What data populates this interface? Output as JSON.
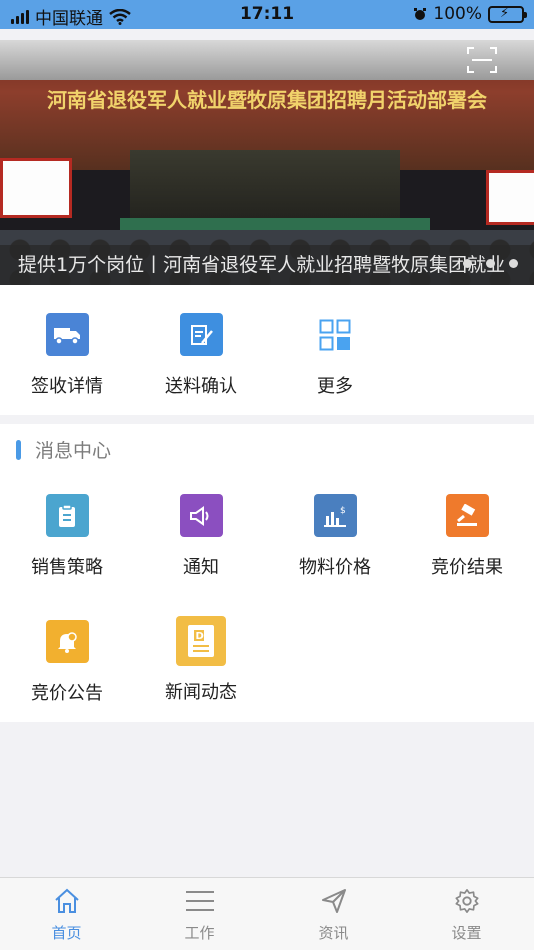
{
  "status_bar": {
    "carrier": "中国联通",
    "time": "17:11",
    "battery": "100%"
  },
  "banner": {
    "title": "河南省退役军人就业暨牧原集团招聘月活动部署会",
    "caption": "提供1万个岗位丨河南省退役军人就业招聘暨牧原集团就业"
  },
  "quick_actions": [
    {
      "label": "签收详情",
      "icon": "truck-icon",
      "color": "#4a84d6"
    },
    {
      "label": "送料确认",
      "icon": "sign-document-icon",
      "color": "#3e8fe0"
    },
    {
      "label": "更多",
      "icon": "grid-icon",
      "color": "#4aa3f0"
    }
  ],
  "message_center": {
    "title": "消息中心",
    "items": [
      {
        "label": "销售策略",
        "icon": "clipboard-icon",
        "color": "#4ba5cf"
      },
      {
        "label": "通知",
        "icon": "speaker-icon",
        "color": "#8b4fc0"
      },
      {
        "label": "物料价格",
        "icon": "price-chart-icon",
        "color": "#4a7fbf"
      },
      {
        "label": "竞价结果",
        "icon": "gavel-icon",
        "color": "#ef7a2c"
      },
      {
        "label": "竞价公告",
        "icon": "bell-icon",
        "color": "#f2b02f"
      },
      {
        "label": "新闻动态",
        "icon": "news-icon",
        "color": "#f2bd45"
      }
    ]
  },
  "tabbar": {
    "tabs": [
      {
        "label": "首页",
        "icon": "home-icon",
        "active": true
      },
      {
        "label": "工作",
        "icon": "menu-icon",
        "active": false
      },
      {
        "label": "资讯",
        "icon": "send-icon",
        "active": false
      },
      {
        "label": "设置",
        "icon": "gear-icon",
        "active": false
      }
    ],
    "active_color": "#4a8fe0"
  }
}
